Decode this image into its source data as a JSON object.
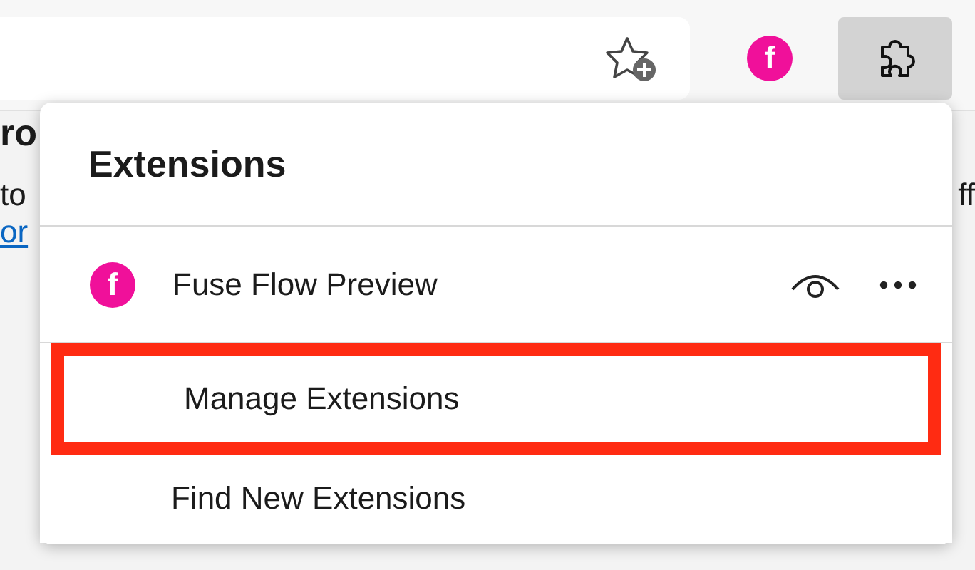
{
  "toolbar": {
    "extension_logo_letter": "f",
    "extensions_button_selected": true
  },
  "page": {
    "heading": "ro",
    "text_left": "to",
    "text_right": "ff",
    "link": "or"
  },
  "menu": {
    "title": "Extensions",
    "extensions": [
      {
        "logo_letter": "f",
        "name": "Fuse Flow Preview"
      }
    ],
    "items": [
      {
        "label": "Manage Extensions",
        "highlighted": true
      },
      {
        "label": "Find New Extensions",
        "highlighted": false
      }
    ]
  }
}
